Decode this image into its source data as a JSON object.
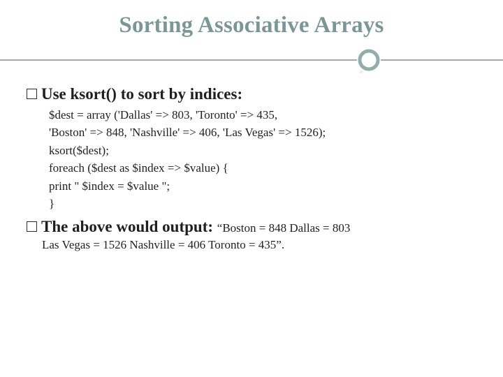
{
  "title": "Sorting Associative Arrays",
  "bullet1": {
    "heading": "Use ksort() to sort by indices:",
    "code_lines": [
      "$dest = array ('Dallas' => 803, 'Toronto' => 435,",
      "'Boston' => 848, 'Nashville' => 406, 'Las Vegas' => 1526);",
      "ksort($dest);",
      "foreach ($dest as $index => $value) {",
      "print \" $index = $value \";",
      "}"
    ]
  },
  "bullet2": {
    "heading": "The above would output:",
    "inline": "“Boston = 848 Dallas = 803",
    "cont": "Las Vegas = 1526 Nashville = 406 Toronto = 435”."
  },
  "ornament": {
    "name": "circle-divider-icon",
    "stroke": "#93adad"
  }
}
